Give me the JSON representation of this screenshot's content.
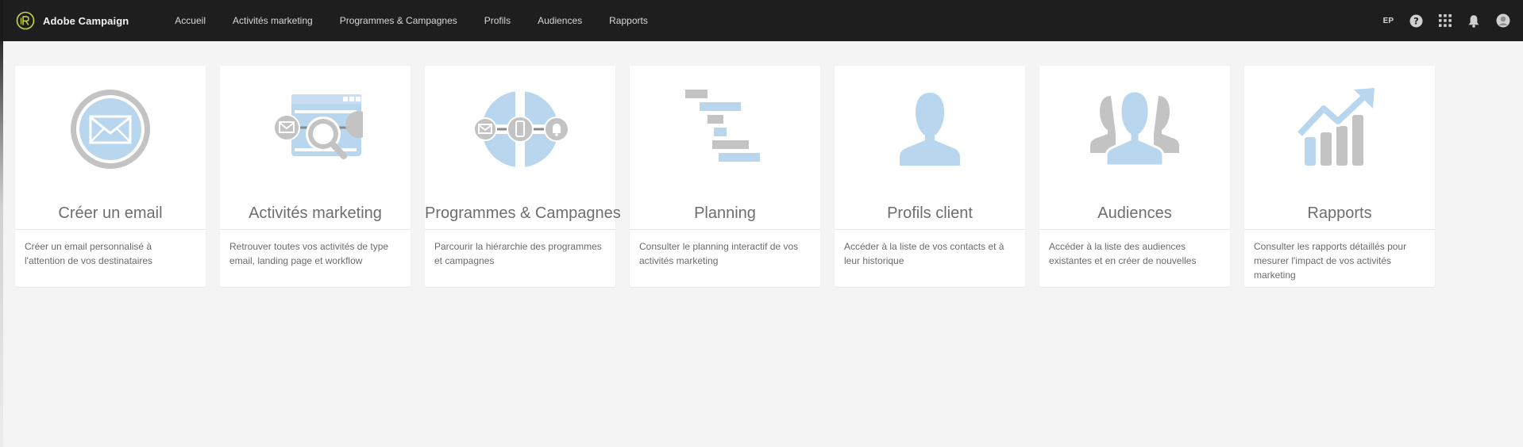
{
  "header": {
    "app_name": "Adobe Campaign",
    "nav": [
      {
        "label": "Accueil"
      },
      {
        "label": "Activités marketing"
      },
      {
        "label": "Programmes & Campagnes"
      },
      {
        "label": "Profils"
      },
      {
        "label": "Audiences"
      },
      {
        "label": "Rapports"
      }
    ],
    "user_initials": "EP"
  },
  "colors": {
    "topbar": "#1e1e1e",
    "icon_blue": "#b9d6ef",
    "icon_gray": "#bdbdbd",
    "page_bg": "#f4f4f4"
  },
  "cards": [
    {
      "icon": "email-icon",
      "title": "Créer un email",
      "description": "Créer un email personnalisé à l'attention de vos destinataires"
    },
    {
      "icon": "marketing-activities-icon",
      "title": "Activités marketing",
      "description": "Retrouver toutes vos activités de type email, landing page et workflow"
    },
    {
      "icon": "programs-campaigns-icon",
      "title": "Programmes & Campagnes",
      "description": "Parcourir la hiérarchie des programmes et campagnes"
    },
    {
      "icon": "planning-icon",
      "title": "Planning",
      "description": "Consulter le planning interactif de vos activités marketing"
    },
    {
      "icon": "profile-icon",
      "title": "Profils client",
      "description": "Accéder à la liste de vos contacts et à leur historique"
    },
    {
      "icon": "audiences-icon",
      "title": "Audiences",
      "description": "Accéder à la liste des audiences existantes et en créer de nouvelles"
    },
    {
      "icon": "reports-icon",
      "title": "Rapports",
      "description": "Consulter les rapports détaillés pour mesurer l'impact de vos activités marketing"
    }
  ]
}
